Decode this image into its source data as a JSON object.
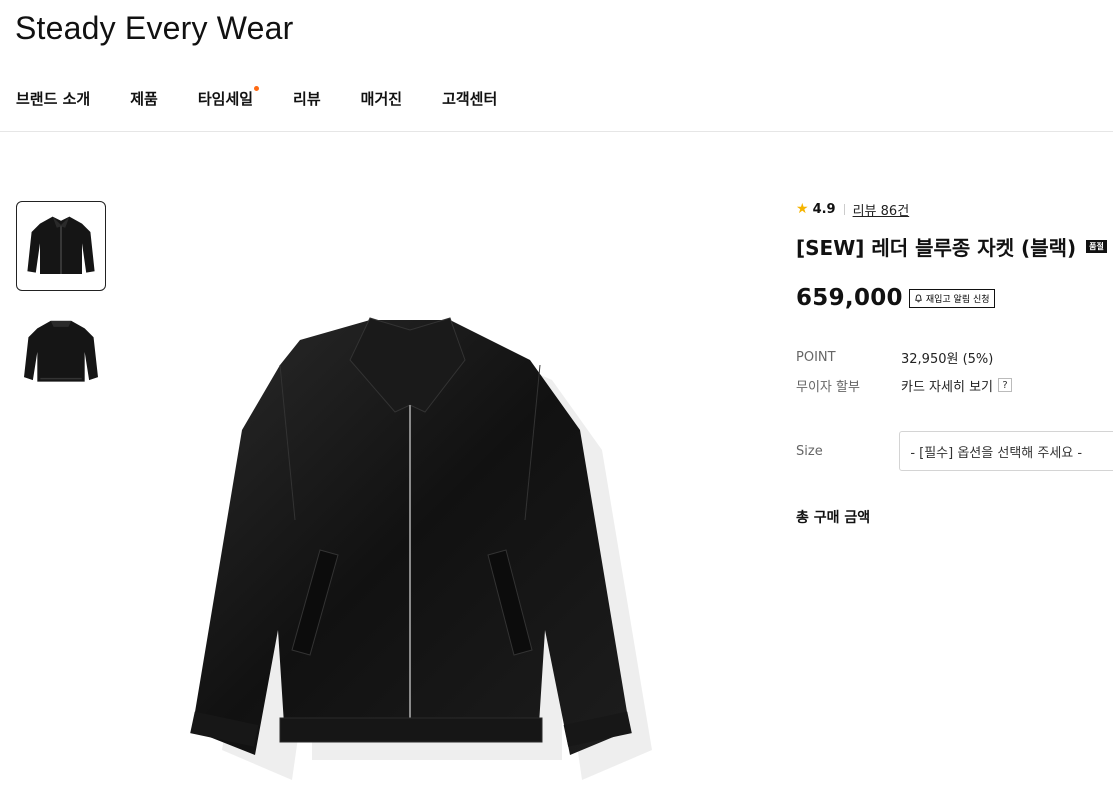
{
  "brand": {
    "logo": "Steady Every Wear"
  },
  "nav": {
    "items": [
      {
        "label": "브랜드 소개"
      },
      {
        "label": "제품"
      },
      {
        "label": "타임세일"
      },
      {
        "label": "리뷰"
      },
      {
        "label": "매거진"
      },
      {
        "label": "고객센터"
      }
    ]
  },
  "product": {
    "rating": "4.9",
    "review_link": "리뷰 86건",
    "title": "[SEW] 레더 블루종 자켓 (블랙)",
    "badge": "품절",
    "price": "659,000",
    "restock_label": "재입고 알림 신청",
    "point_label": "POINT",
    "point_value": "32,950원 (5%)",
    "installment_label": "무이자 할부",
    "installment_value": "카드 자세히 보기",
    "help_mark": "?",
    "size_label": "Size",
    "size_placeholder": "- [필수] 옵션을 선택해 주세요 -",
    "total_label": "총 구매 금액"
  },
  "colors": {
    "accent_dot": "#ff6a13",
    "star": "#f5b400"
  }
}
